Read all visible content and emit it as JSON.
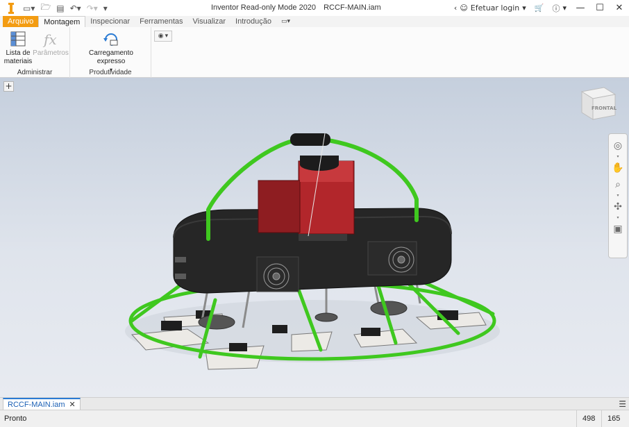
{
  "titlebar": {
    "app_title": "Inventor Read-only Mode 2020",
    "doc_title": "RCCF-MAIN.iam",
    "login_label": "Efetuar login",
    "qat_icons": [
      "new-icon",
      "open-icon",
      "save-icon",
      "undo-icon",
      "redo-icon",
      "customize-icon"
    ]
  },
  "tabs": [
    {
      "label": "Arquivo"
    },
    {
      "label": "Montagem"
    },
    {
      "label": "Inspecionar"
    },
    {
      "label": "Ferramentas"
    },
    {
      "label": "Visualizar"
    },
    {
      "label": "Introdução"
    }
  ],
  "ribbon": {
    "panels": {
      "administrar": {
        "title": "Administrar",
        "bom_label_1": "Lista de",
        "bom_label_2": "materiais",
        "params_label": "Parâmetros"
      },
      "produtividade": {
        "title": "Produtividade",
        "express_label": "Carregamento expresso"
      }
    }
  },
  "viewport": {
    "viewcube_label": "FRONTAL",
    "background_top": "#c5cfdd",
    "background_bottom": "#e8ebf1"
  },
  "doc_tabs": [
    {
      "label": "RCCF-MAIN.iam"
    }
  ],
  "status": {
    "text": "Pronto",
    "count_1": "498",
    "count_2": "165"
  },
  "colors": {
    "file_tab": "#f39c12",
    "frame_green": "#3fc81f",
    "motor_red": "#b2262b",
    "body_dark": "#262626"
  }
}
